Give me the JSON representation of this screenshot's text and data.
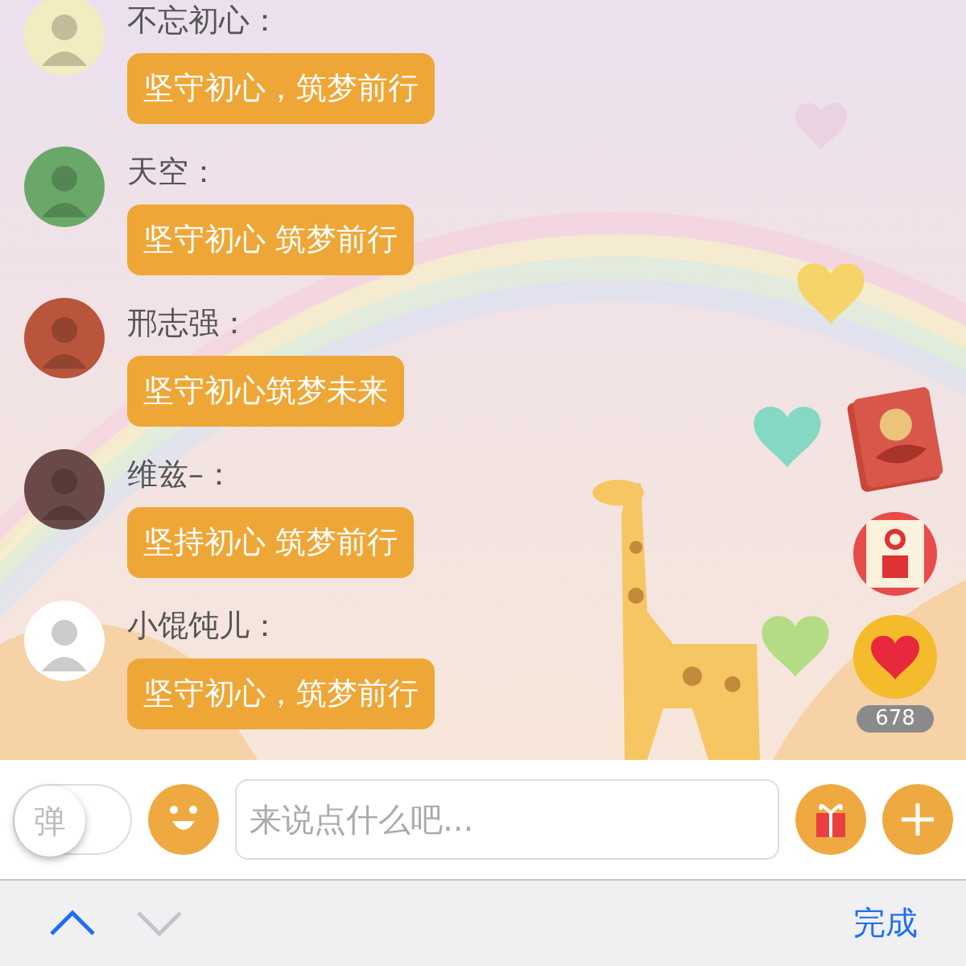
{
  "messages": [
    {
      "name": "不忘初心：",
      "text": "坚守初心，筑梦前行"
    },
    {
      "name": "天空：",
      "text": "坚守初心 筑梦前行"
    },
    {
      "name": "邢志强：",
      "text": "坚守初心筑梦未来"
    },
    {
      "name": "维兹–：",
      "text": "坚持初心 筑梦前行"
    },
    {
      "name": "小馄饨儿：",
      "text": "坚守初心，筑梦前行"
    }
  ],
  "like_count": "678",
  "input_bar": {
    "danmaku_toggle": {
      "label": "弹",
      "on": false
    },
    "placeholder": "来说点什么吧..."
  },
  "keyboard_toolbar": {
    "arrows": [
      {
        "kind": "up",
        "disabled": false
      },
      {
        "kind": "down",
        "disabled": true
      }
    ],
    "done": "完成"
  }
}
